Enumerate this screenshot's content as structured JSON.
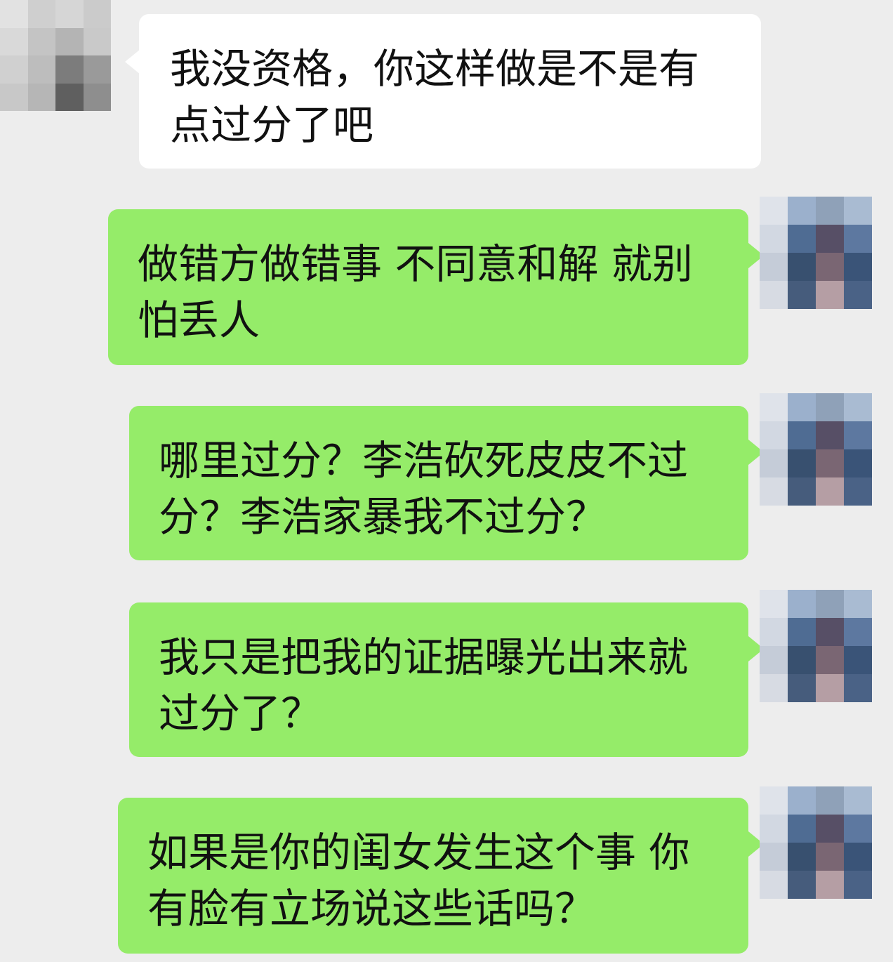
{
  "chat": {
    "messages": [
      {
        "side": "in",
        "text": "我没资格，你这样做是不是有点过分了吧"
      },
      {
        "side": "out",
        "text": "做错方做错事 不同意和解 就别怕丢人"
      },
      {
        "side": "out",
        "text": "哪里过分？李浩砍死皮皮不过分？李浩家暴我不过分？"
      },
      {
        "side": "out",
        "text": "我只是把我的证据曝光出来就过分了？"
      },
      {
        "side": "out",
        "text": "如果是你的闺女发生这个事 你有脸有立场说这些话吗？"
      }
    ]
  },
  "colors": {
    "background": "#ededed",
    "incoming_bubble": "#ffffff",
    "outgoing_bubble": "#95ec69",
    "text": "#111111"
  },
  "avatars": {
    "contact": "pixelated-avatar",
    "self": "pixelated-avatar"
  }
}
